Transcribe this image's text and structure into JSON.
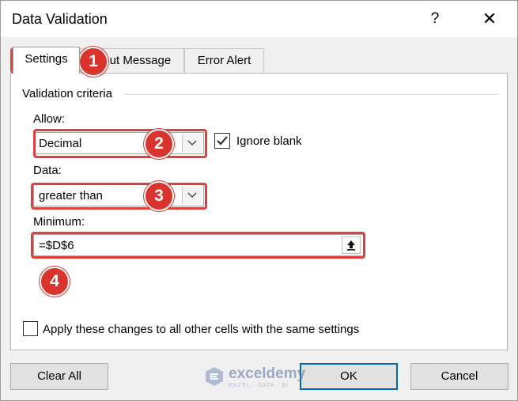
{
  "window": {
    "title": "Data Validation",
    "help_label": "?",
    "close_label": "✕"
  },
  "tabs": [
    {
      "label": "Settings",
      "active": true
    },
    {
      "label": "Input Message",
      "active": false
    },
    {
      "label": "Error Alert",
      "active": false
    }
  ],
  "criteria": {
    "group_title": "Validation criteria",
    "allow_label": "Allow:",
    "allow_value": "Decimal",
    "ignore_blank_label": "Ignore blank",
    "ignore_blank_checked": true,
    "data_label": "Data:",
    "data_value": "greater than",
    "minimum_label": "Minimum:",
    "minimum_value": "=$D$6"
  },
  "apply_all": {
    "label": "Apply these changes to all other cells with the same settings",
    "checked": false
  },
  "buttons": {
    "clear_all": "Clear All",
    "ok": "OK",
    "cancel": "Cancel"
  },
  "annotations": [
    "1",
    "2",
    "3",
    "4"
  ],
  "watermark": {
    "name": "exceldemy",
    "tagline": "EXCEL · DATA · BI"
  },
  "colors": {
    "annotation": "#d9342e",
    "highlight": "#e0403c",
    "default_button_border": "#0067c0"
  }
}
